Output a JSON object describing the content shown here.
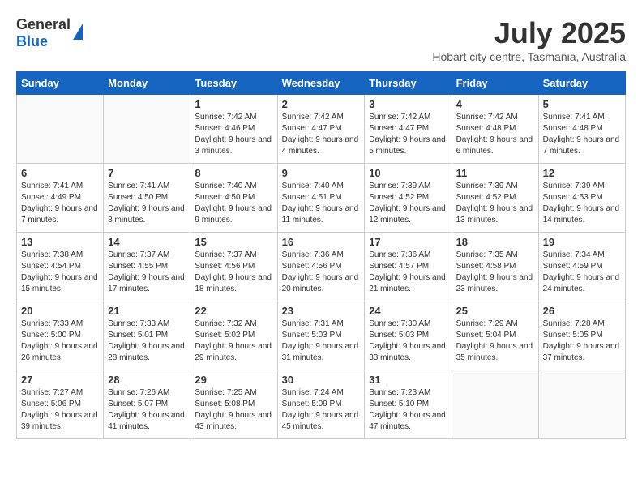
{
  "header": {
    "logo_general": "General",
    "logo_blue": "Blue",
    "month": "July 2025",
    "location": "Hobart city centre, Tasmania, Australia"
  },
  "days_of_week": [
    "Sunday",
    "Monday",
    "Tuesday",
    "Wednesday",
    "Thursday",
    "Friday",
    "Saturday"
  ],
  "weeks": [
    [
      {
        "day": "",
        "empty": true
      },
      {
        "day": "",
        "empty": true
      },
      {
        "day": "1",
        "sunrise": "7:42 AM",
        "sunset": "4:46 PM",
        "daylight": "9 hours and 3 minutes."
      },
      {
        "day": "2",
        "sunrise": "7:42 AM",
        "sunset": "4:47 PM",
        "daylight": "9 hours and 4 minutes."
      },
      {
        "day": "3",
        "sunrise": "7:42 AM",
        "sunset": "4:47 PM",
        "daylight": "9 hours and 5 minutes."
      },
      {
        "day": "4",
        "sunrise": "7:42 AM",
        "sunset": "4:48 PM",
        "daylight": "9 hours and 6 minutes."
      },
      {
        "day": "5",
        "sunrise": "7:41 AM",
        "sunset": "4:48 PM",
        "daylight": "9 hours and 7 minutes."
      }
    ],
    [
      {
        "day": "6",
        "sunrise": "7:41 AM",
        "sunset": "4:49 PM",
        "daylight": "9 hours and 7 minutes."
      },
      {
        "day": "7",
        "sunrise": "7:41 AM",
        "sunset": "4:50 PM",
        "daylight": "9 hours and 8 minutes."
      },
      {
        "day": "8",
        "sunrise": "7:40 AM",
        "sunset": "4:50 PM",
        "daylight": "9 hours and 9 minutes."
      },
      {
        "day": "9",
        "sunrise": "7:40 AM",
        "sunset": "4:51 PM",
        "daylight": "9 hours and 11 minutes."
      },
      {
        "day": "10",
        "sunrise": "7:39 AM",
        "sunset": "4:52 PM",
        "daylight": "9 hours and 12 minutes."
      },
      {
        "day": "11",
        "sunrise": "7:39 AM",
        "sunset": "4:52 PM",
        "daylight": "9 hours and 13 minutes."
      },
      {
        "day": "12",
        "sunrise": "7:39 AM",
        "sunset": "4:53 PM",
        "daylight": "9 hours and 14 minutes."
      }
    ],
    [
      {
        "day": "13",
        "sunrise": "7:38 AM",
        "sunset": "4:54 PM",
        "daylight": "9 hours and 15 minutes."
      },
      {
        "day": "14",
        "sunrise": "7:37 AM",
        "sunset": "4:55 PM",
        "daylight": "9 hours and 17 minutes."
      },
      {
        "day": "15",
        "sunrise": "7:37 AM",
        "sunset": "4:56 PM",
        "daylight": "9 hours and 18 minutes."
      },
      {
        "day": "16",
        "sunrise": "7:36 AM",
        "sunset": "4:56 PM",
        "daylight": "9 hours and 20 minutes."
      },
      {
        "day": "17",
        "sunrise": "7:36 AM",
        "sunset": "4:57 PM",
        "daylight": "9 hours and 21 minutes."
      },
      {
        "day": "18",
        "sunrise": "7:35 AM",
        "sunset": "4:58 PM",
        "daylight": "9 hours and 23 minutes."
      },
      {
        "day": "19",
        "sunrise": "7:34 AM",
        "sunset": "4:59 PM",
        "daylight": "9 hours and 24 minutes."
      }
    ],
    [
      {
        "day": "20",
        "sunrise": "7:33 AM",
        "sunset": "5:00 PM",
        "daylight": "9 hours and 26 minutes."
      },
      {
        "day": "21",
        "sunrise": "7:33 AM",
        "sunset": "5:01 PM",
        "daylight": "9 hours and 28 minutes."
      },
      {
        "day": "22",
        "sunrise": "7:32 AM",
        "sunset": "5:02 PM",
        "daylight": "9 hours and 29 minutes."
      },
      {
        "day": "23",
        "sunrise": "7:31 AM",
        "sunset": "5:03 PM",
        "daylight": "9 hours and 31 minutes."
      },
      {
        "day": "24",
        "sunrise": "7:30 AM",
        "sunset": "5:03 PM",
        "daylight": "9 hours and 33 minutes."
      },
      {
        "day": "25",
        "sunrise": "7:29 AM",
        "sunset": "5:04 PM",
        "daylight": "9 hours and 35 minutes."
      },
      {
        "day": "26",
        "sunrise": "7:28 AM",
        "sunset": "5:05 PM",
        "daylight": "9 hours and 37 minutes."
      }
    ],
    [
      {
        "day": "27",
        "sunrise": "7:27 AM",
        "sunset": "5:06 PM",
        "daylight": "9 hours and 39 minutes."
      },
      {
        "day": "28",
        "sunrise": "7:26 AM",
        "sunset": "5:07 PM",
        "daylight": "9 hours and 41 minutes."
      },
      {
        "day": "29",
        "sunrise": "7:25 AM",
        "sunset": "5:08 PM",
        "daylight": "9 hours and 43 minutes."
      },
      {
        "day": "30",
        "sunrise": "7:24 AM",
        "sunset": "5:09 PM",
        "daylight": "9 hours and 45 minutes."
      },
      {
        "day": "31",
        "sunrise": "7:23 AM",
        "sunset": "5:10 PM",
        "daylight": "9 hours and 47 minutes."
      },
      {
        "day": "",
        "empty": true
      },
      {
        "day": "",
        "empty": true
      }
    ]
  ],
  "labels": {
    "sunrise": "Sunrise:",
    "sunset": "Sunset:",
    "daylight": "Daylight:"
  }
}
